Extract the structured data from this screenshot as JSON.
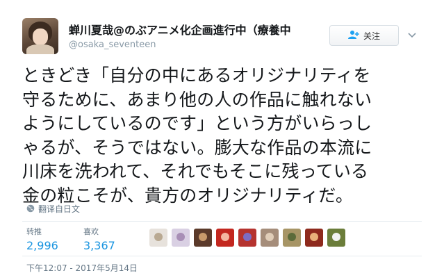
{
  "tweet": {
    "author": {
      "display_name": "蝉川夏哉@のぶアニメ化企画進行中（療養中",
      "handle": "@osaka_seventeen"
    },
    "follow_button": {
      "label": "关注",
      "icon": "add-user-icon"
    },
    "menu_icon": "chevron-down-icon",
    "text_lines": [
      "ときどき「自分の中にあるオリジナリティを",
      "守るために、あまり他の人の作品に触れない",
      "ようにしているのです」という方がいらっし",
      "ゃるが、そうではない。膨大な作品の本流に",
      "川床を洗われて、それでもそこに残っている",
      "金の粒こそが、貴方のオリジナリティだ。"
    ],
    "translate": {
      "label": "翻译自日文",
      "icon": "globe-icon"
    },
    "stats": {
      "retweets_label": "转推",
      "retweets": "2,996",
      "likes_label": "喜欢",
      "likes": "3,367"
    },
    "likers": [
      {
        "color": "#e7e2dc",
        "accent": "#b9a992"
      },
      {
        "color": "#d9d0e3",
        "accent": "#a88fb6"
      },
      {
        "color": "#5b3a2a",
        "accent": "#c89a6b"
      },
      {
        "color": "#c3271f",
        "accent": "#f4b6a0"
      },
      {
        "color": "#b5332f",
        "accent": "#7c6cc4"
      },
      {
        "color": "#a58d7a",
        "accent": "#e0cdb8"
      },
      {
        "color": "#a79566",
        "accent": "#5c6b3a"
      },
      {
        "color": "#8e2a1d",
        "accent": "#e9b27a"
      },
      {
        "color": "#6b7d3a",
        "accent": "#f2f2f2"
      }
    ],
    "timestamp": "下午12:07 - 2017年5月14日"
  }
}
